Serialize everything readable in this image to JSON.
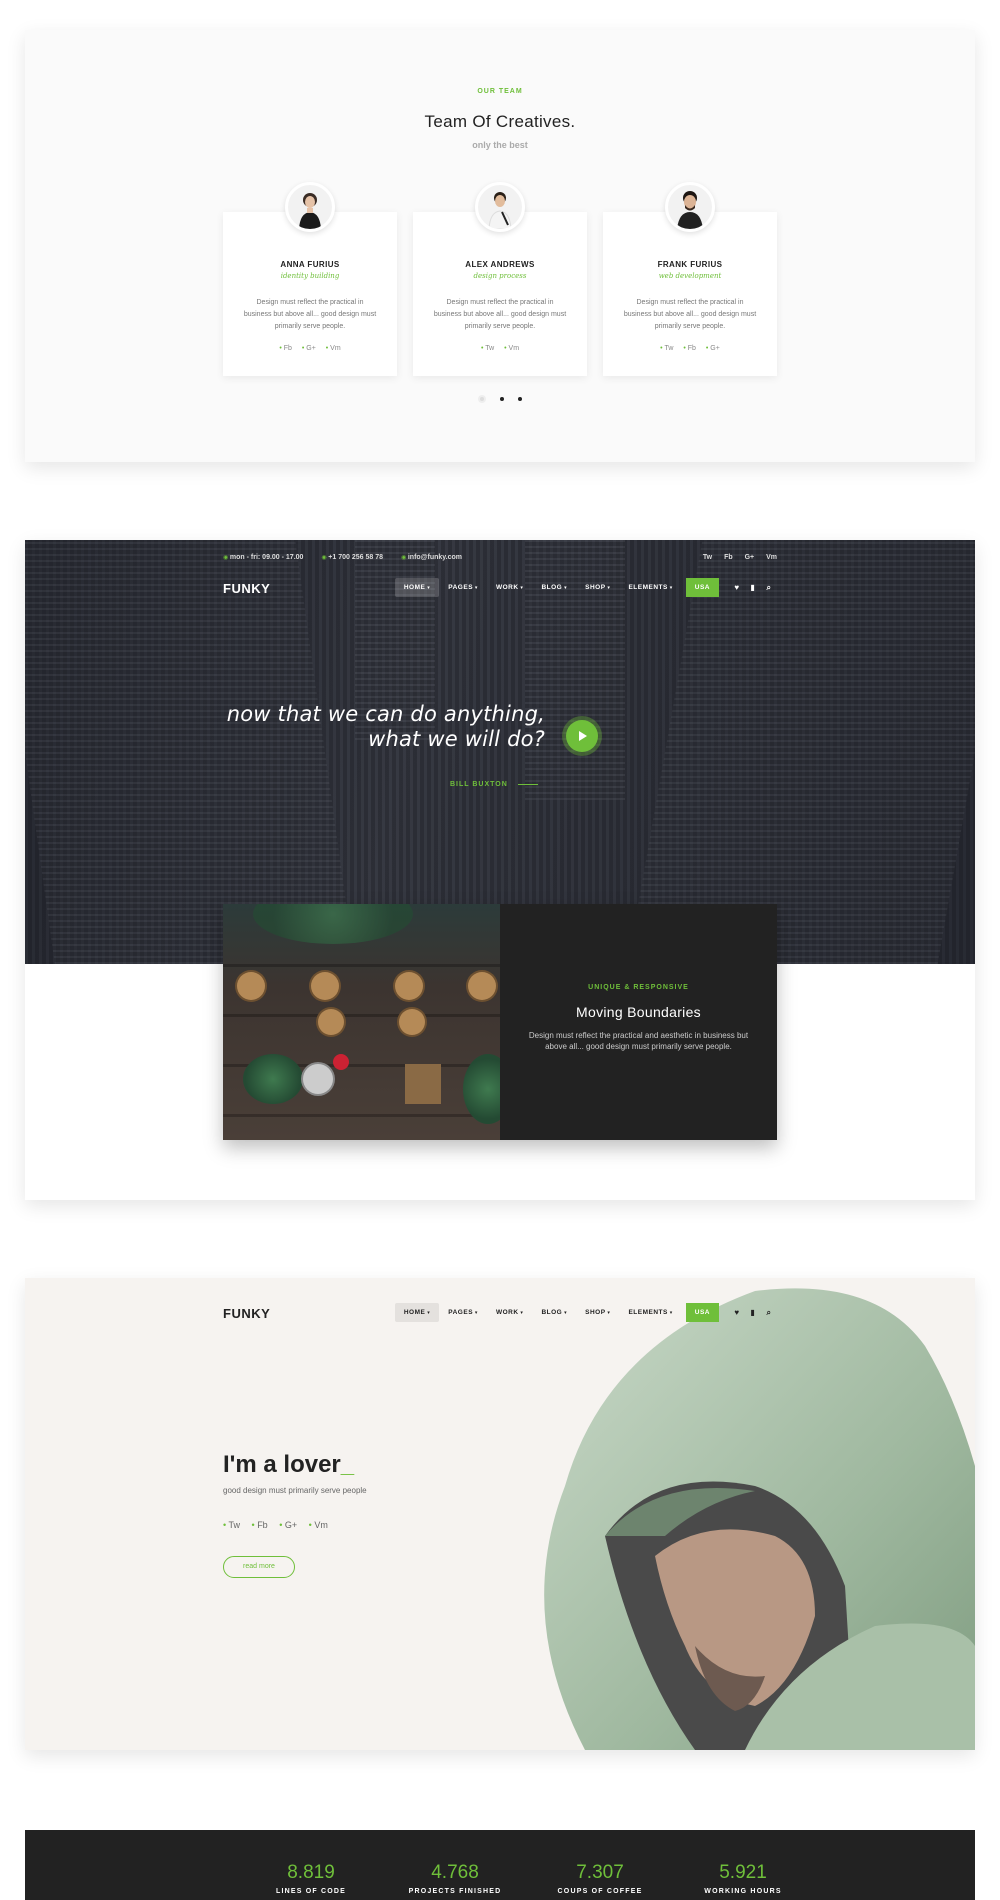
{
  "team": {
    "eyebrow": "OUR TEAM",
    "title": "Team Of Creatives.",
    "subtitle": "only the best",
    "members": [
      {
        "name": "ANNA FURIUS",
        "role": "identity building",
        "desc": "Design must reflect the practical in business but above all... good design must primarily serve people.",
        "social": [
          "Fb",
          "G+",
          "Vm"
        ]
      },
      {
        "name": "ALEX ANDREWS",
        "role": "design process",
        "desc": "Design must reflect the practical in business but above all... good design must primarily serve people.",
        "social": [
          "Tw",
          "Vm"
        ]
      },
      {
        "name": "FRANK FURIUS",
        "role": "web development",
        "desc": "Design must reflect the practical in business but above all... good design must primarily serve people.",
        "social": [
          "Tw",
          "Fb",
          "G+"
        ]
      }
    ]
  },
  "topbar": {
    "hours": "mon - fri: 09.00 - 17.00",
    "phone": "+1 700 256 58 78",
    "email": "info@funky.com",
    "social": [
      "Tw",
      "Fb",
      "G+",
      "Vm"
    ]
  },
  "nav": {
    "logo": "FUNKY",
    "items": [
      "HOME",
      "PAGES",
      "WORK",
      "BLOG",
      "SHOP",
      "ELEMENTS"
    ],
    "lang": "USA",
    "icons": [
      "heart-icon",
      "bag-icon",
      "search-icon"
    ]
  },
  "hero": {
    "quote_line1": "now that we can do anything,",
    "quote_line2": "what we will do?",
    "author": "BILL BUXTON"
  },
  "feature": {
    "eyebrow": "UNIQUE & RESPONSIVE",
    "title": "Moving Boundaries",
    "text": "Design must reflect the practical and aesthetic in business but above all... good design must primarily serve people."
  },
  "lover": {
    "title": "I'm a lover",
    "cursor": "_",
    "subtitle": "good design must primarily serve people",
    "social": [
      "Tw",
      "Fb",
      "G+",
      "Vm"
    ],
    "button": "read more"
  },
  "stats": [
    {
      "value": "8.819",
      "label": "LINES OF CODE"
    },
    {
      "value": "4.768",
      "label": "PROJECTS FINISHED"
    },
    {
      "value": "7.307",
      "label": "COUPS OF COFFEE"
    },
    {
      "value": "5.921",
      "label": "WORKING HOURS"
    }
  ],
  "colors": {
    "accent": "#6fbf3a",
    "dark": "#222222",
    "light_bg": "#fafafa",
    "beige_bg": "#f6f3f0"
  }
}
